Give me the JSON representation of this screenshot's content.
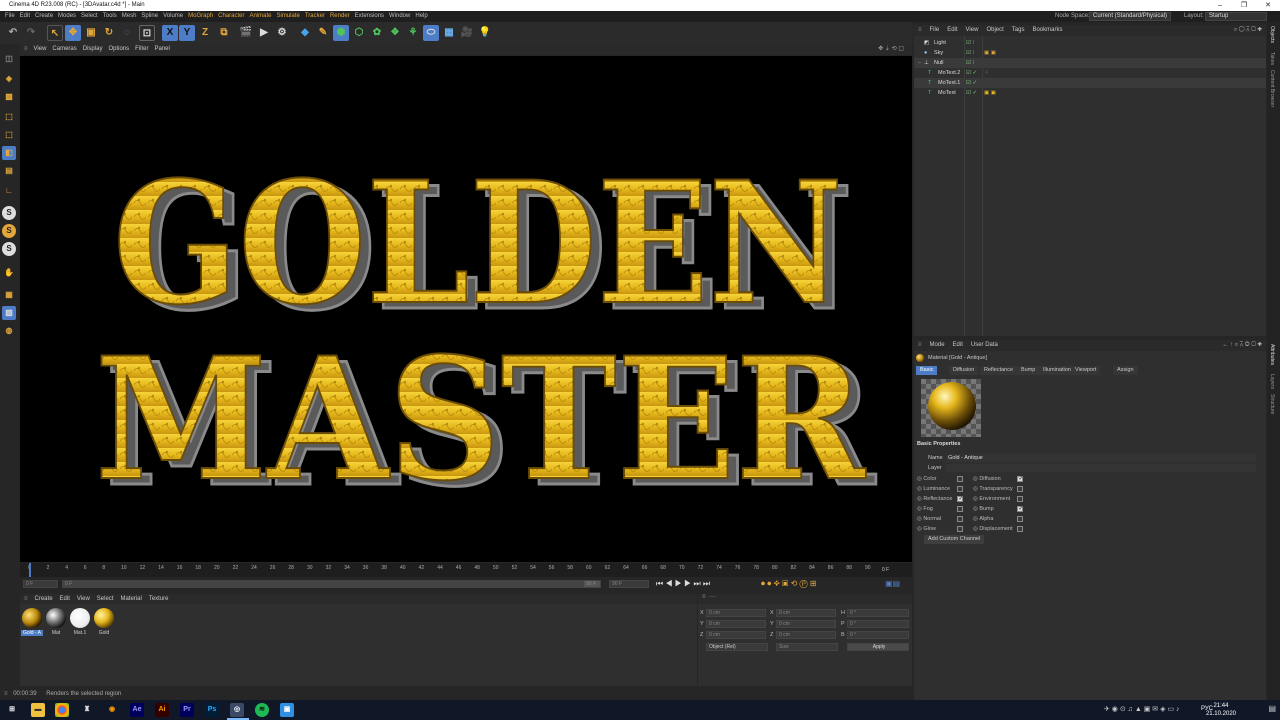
{
  "window": {
    "title": "Cinema 4D R23.008 (RC) - [3DAvatar.c4d *] - Main"
  },
  "menubar": {
    "items": [
      "File",
      "Edit",
      "Create",
      "Modes",
      "Select",
      "Tools",
      "Mesh",
      "Spline",
      "Volume",
      "MoGraph",
      "Character",
      "Animate",
      "Simulate",
      "Tracker",
      "Render",
      "Extensions",
      "Window",
      "Help"
    ],
    "node_space_label": "Node Space:",
    "node_space_value": "Current (Standard/Physical)",
    "layout_label": "Layout:",
    "layout_value": "Startup"
  },
  "viewport": {
    "menu": [
      "View",
      "Cameras",
      "Display",
      "Options",
      "Filter",
      "Panel"
    ],
    "line1": "GOLDEN",
    "line2": "MASTER"
  },
  "timeline": {
    "ticks": [
      "0",
      "2",
      "4",
      "6",
      "8",
      "10",
      "12",
      "14",
      "16",
      "18",
      "20",
      "22",
      "24",
      "26",
      "28",
      "30",
      "32",
      "34",
      "36",
      "38",
      "40",
      "42",
      "44",
      "46",
      "48",
      "50",
      "52",
      "54",
      "56",
      "58",
      "60",
      "62",
      "64",
      "66",
      "68",
      "70",
      "72",
      "74",
      "76",
      "78",
      "80",
      "82",
      "84",
      "86",
      "88",
      "90"
    ],
    "end_label": "0 F",
    "current_frame": "0 F",
    "start_field": "0 F",
    "end_field": "90 F",
    "end_field2": "90 F"
  },
  "material_manager": {
    "menu": [
      "Create",
      "Edit",
      "View",
      "Select",
      "Material",
      "Texture"
    ],
    "materials": [
      {
        "label": "Gold - A"
      },
      {
        "label": "Mat"
      },
      {
        "label": "Mat.1"
      },
      {
        "label": "Gold"
      }
    ]
  },
  "coordinates": {
    "pos_labels": [
      "X",
      "Y",
      "Z"
    ],
    "size_labels": [
      "X",
      "Y",
      "Z"
    ],
    "rot_labels": [
      "H",
      "P",
      "B"
    ],
    "pos_values": [
      "0 cm",
      "0 cm",
      "0 cm"
    ],
    "size_values": [
      "0 cm",
      "0 cm",
      "0 cm"
    ],
    "rot_values": [
      "0 °",
      "0 °",
      "0 °"
    ],
    "mode_select": "Object (Rel)",
    "size_select": "Size",
    "apply_label": "Apply"
  },
  "status": {
    "time": "00:00:39",
    "message": "Renders the selected region"
  },
  "object_manager": {
    "menu": [
      "File",
      "Edit",
      "View",
      "Object",
      "Tags",
      "Bookmarks"
    ],
    "objects": [
      {
        "name": "Light"
      },
      {
        "name": "Sky"
      },
      {
        "name": "Null"
      },
      {
        "name": "MoText.2"
      },
      {
        "name": "MoText.1"
      },
      {
        "name": "MoText"
      }
    ]
  },
  "attributes": {
    "menu": [
      "Mode",
      "Edit",
      "User Data"
    ],
    "header": "Material [Gold - Antique]",
    "tabs": [
      "Basic",
      "Diffusion",
      "Reflectance",
      "Bump",
      "Illumination",
      "Viewport",
      "Assign"
    ],
    "section_title": "Basic Properties",
    "name_label": "Name",
    "name_value": "Gold - Antique",
    "layer_label": "Layer",
    "channels_left": [
      {
        "label": "Color",
        "checked": false
      },
      {
        "label": "Luminance",
        "checked": false
      },
      {
        "label": "Reflectance",
        "checked": true
      },
      {
        "label": "Fog",
        "checked": false
      },
      {
        "label": "Normal",
        "checked": false
      },
      {
        "label": "Glow",
        "checked": false
      }
    ],
    "channels_right": [
      {
        "label": "Diffusion",
        "checked": true
      },
      {
        "label": "Transparency",
        "checked": false
      },
      {
        "label": "Environment",
        "checked": false
      },
      {
        "label": "Bump",
        "checked": true
      },
      {
        "label": "Alpha",
        "checked": false
      },
      {
        "label": "Displacement",
        "checked": false
      }
    ],
    "add_channel_label": "Add Custom Channel"
  },
  "side_tabs": [
    "Objects",
    "Takes",
    "Content Browser",
    "Attributes",
    "Layers",
    "Structure"
  ],
  "taskbar": {
    "lang": "РУС",
    "time": "21:44",
    "date": "21.10.2020"
  },
  "colors": {
    "gold": "#e6b81c",
    "accent": "#4d7dc7",
    "orange": "#e2a63a"
  }
}
